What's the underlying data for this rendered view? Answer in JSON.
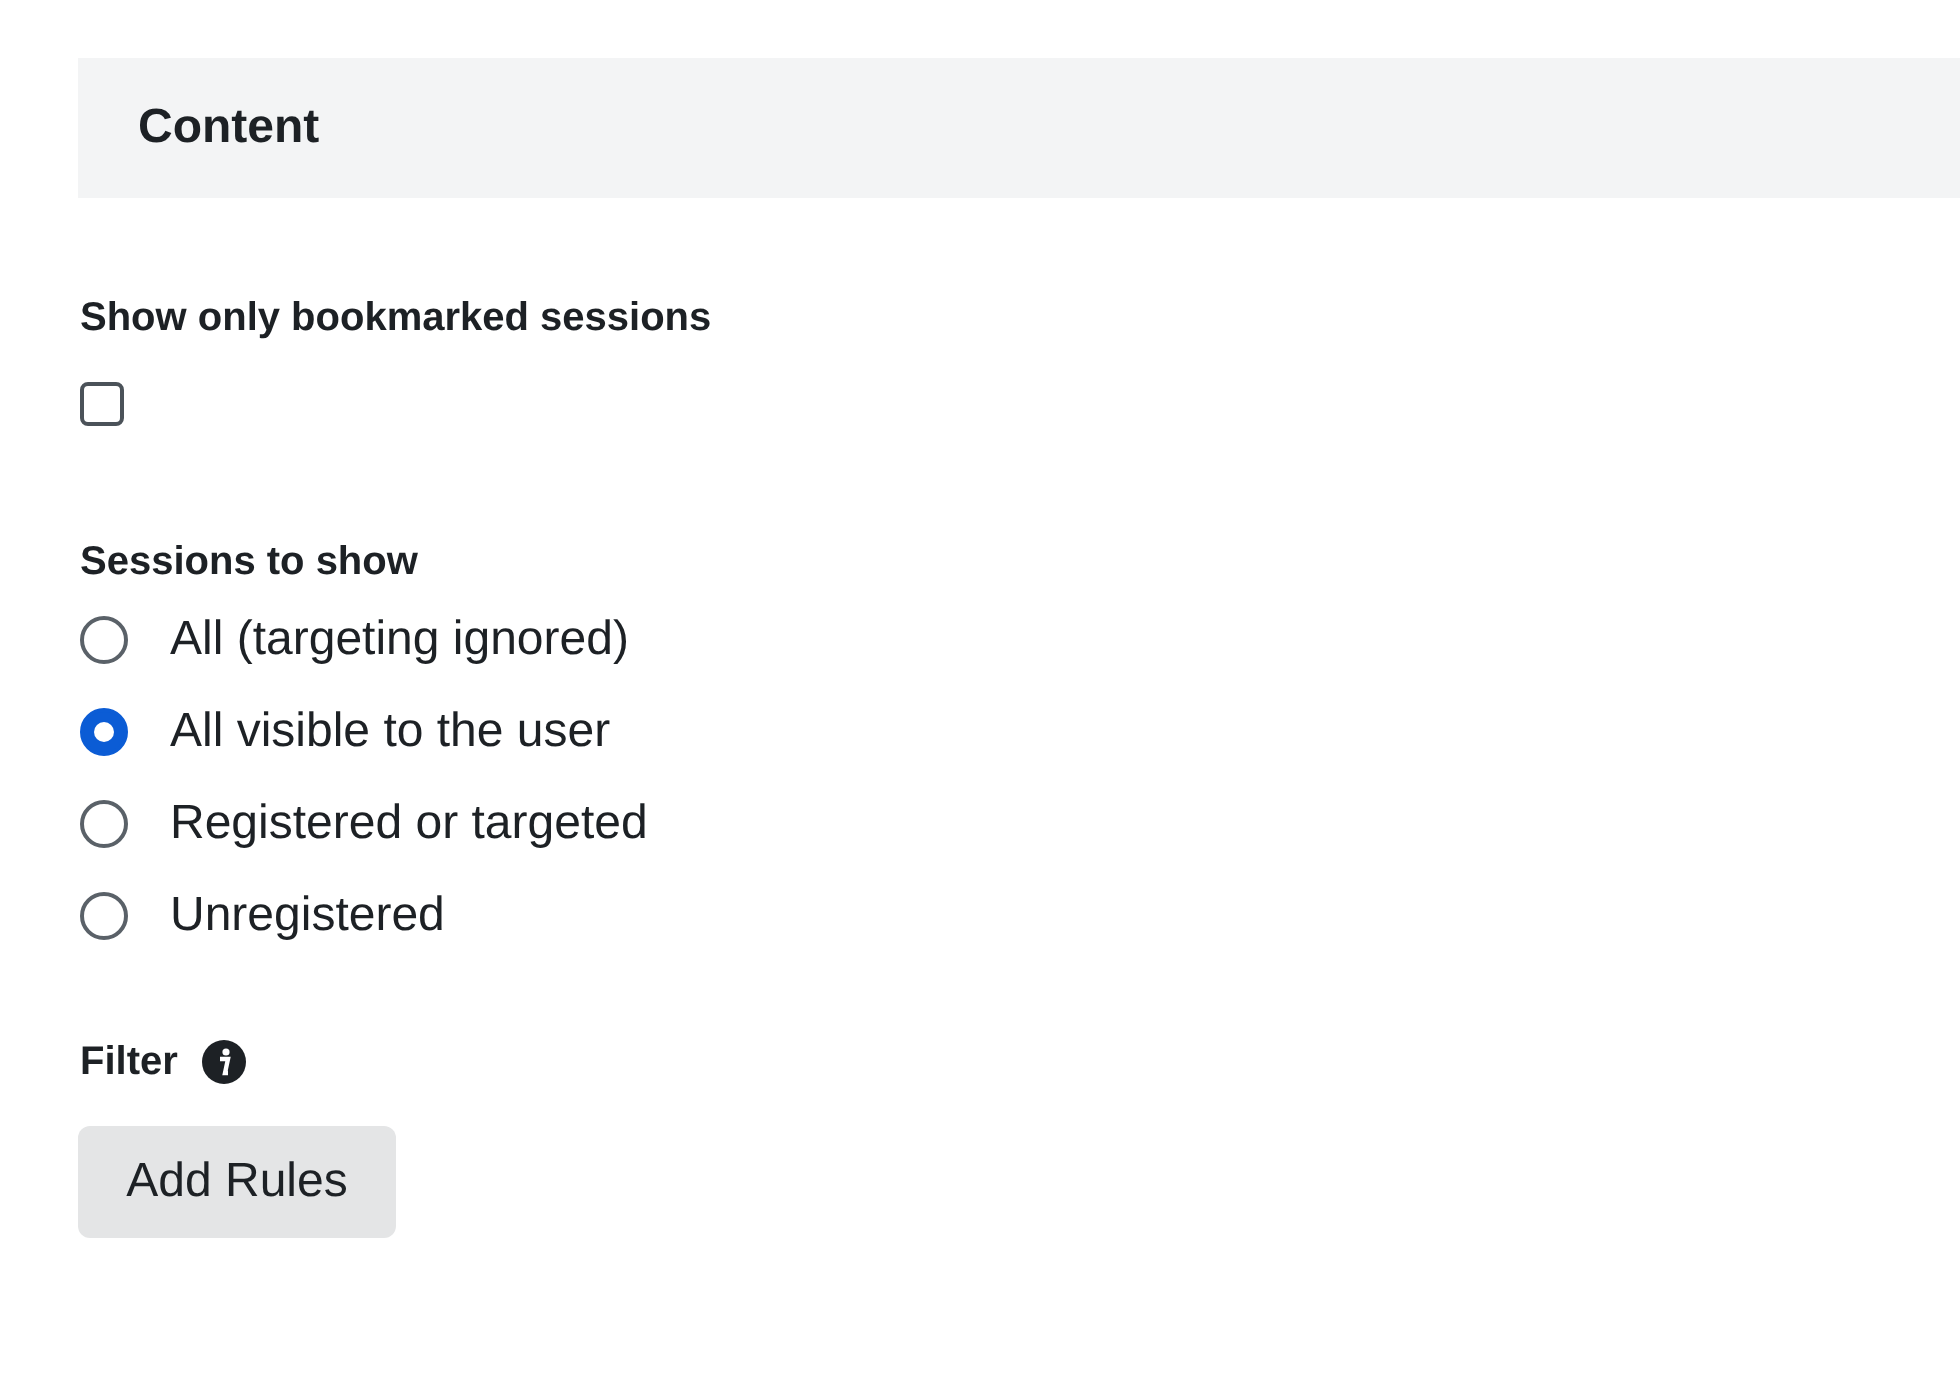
{
  "section": {
    "title": "Content"
  },
  "bookmarked": {
    "label": "Show only bookmarked sessions",
    "checked": false
  },
  "sessions": {
    "label": "Sessions to show",
    "options": [
      {
        "label": "All (targeting ignored)",
        "selected": false
      },
      {
        "label": "All visible to the user",
        "selected": true
      },
      {
        "label": "Registered or targeted",
        "selected": false
      },
      {
        "label": "Unregistered",
        "selected": false
      }
    ]
  },
  "filter": {
    "label": "Filter",
    "button": "Add Rules"
  }
}
